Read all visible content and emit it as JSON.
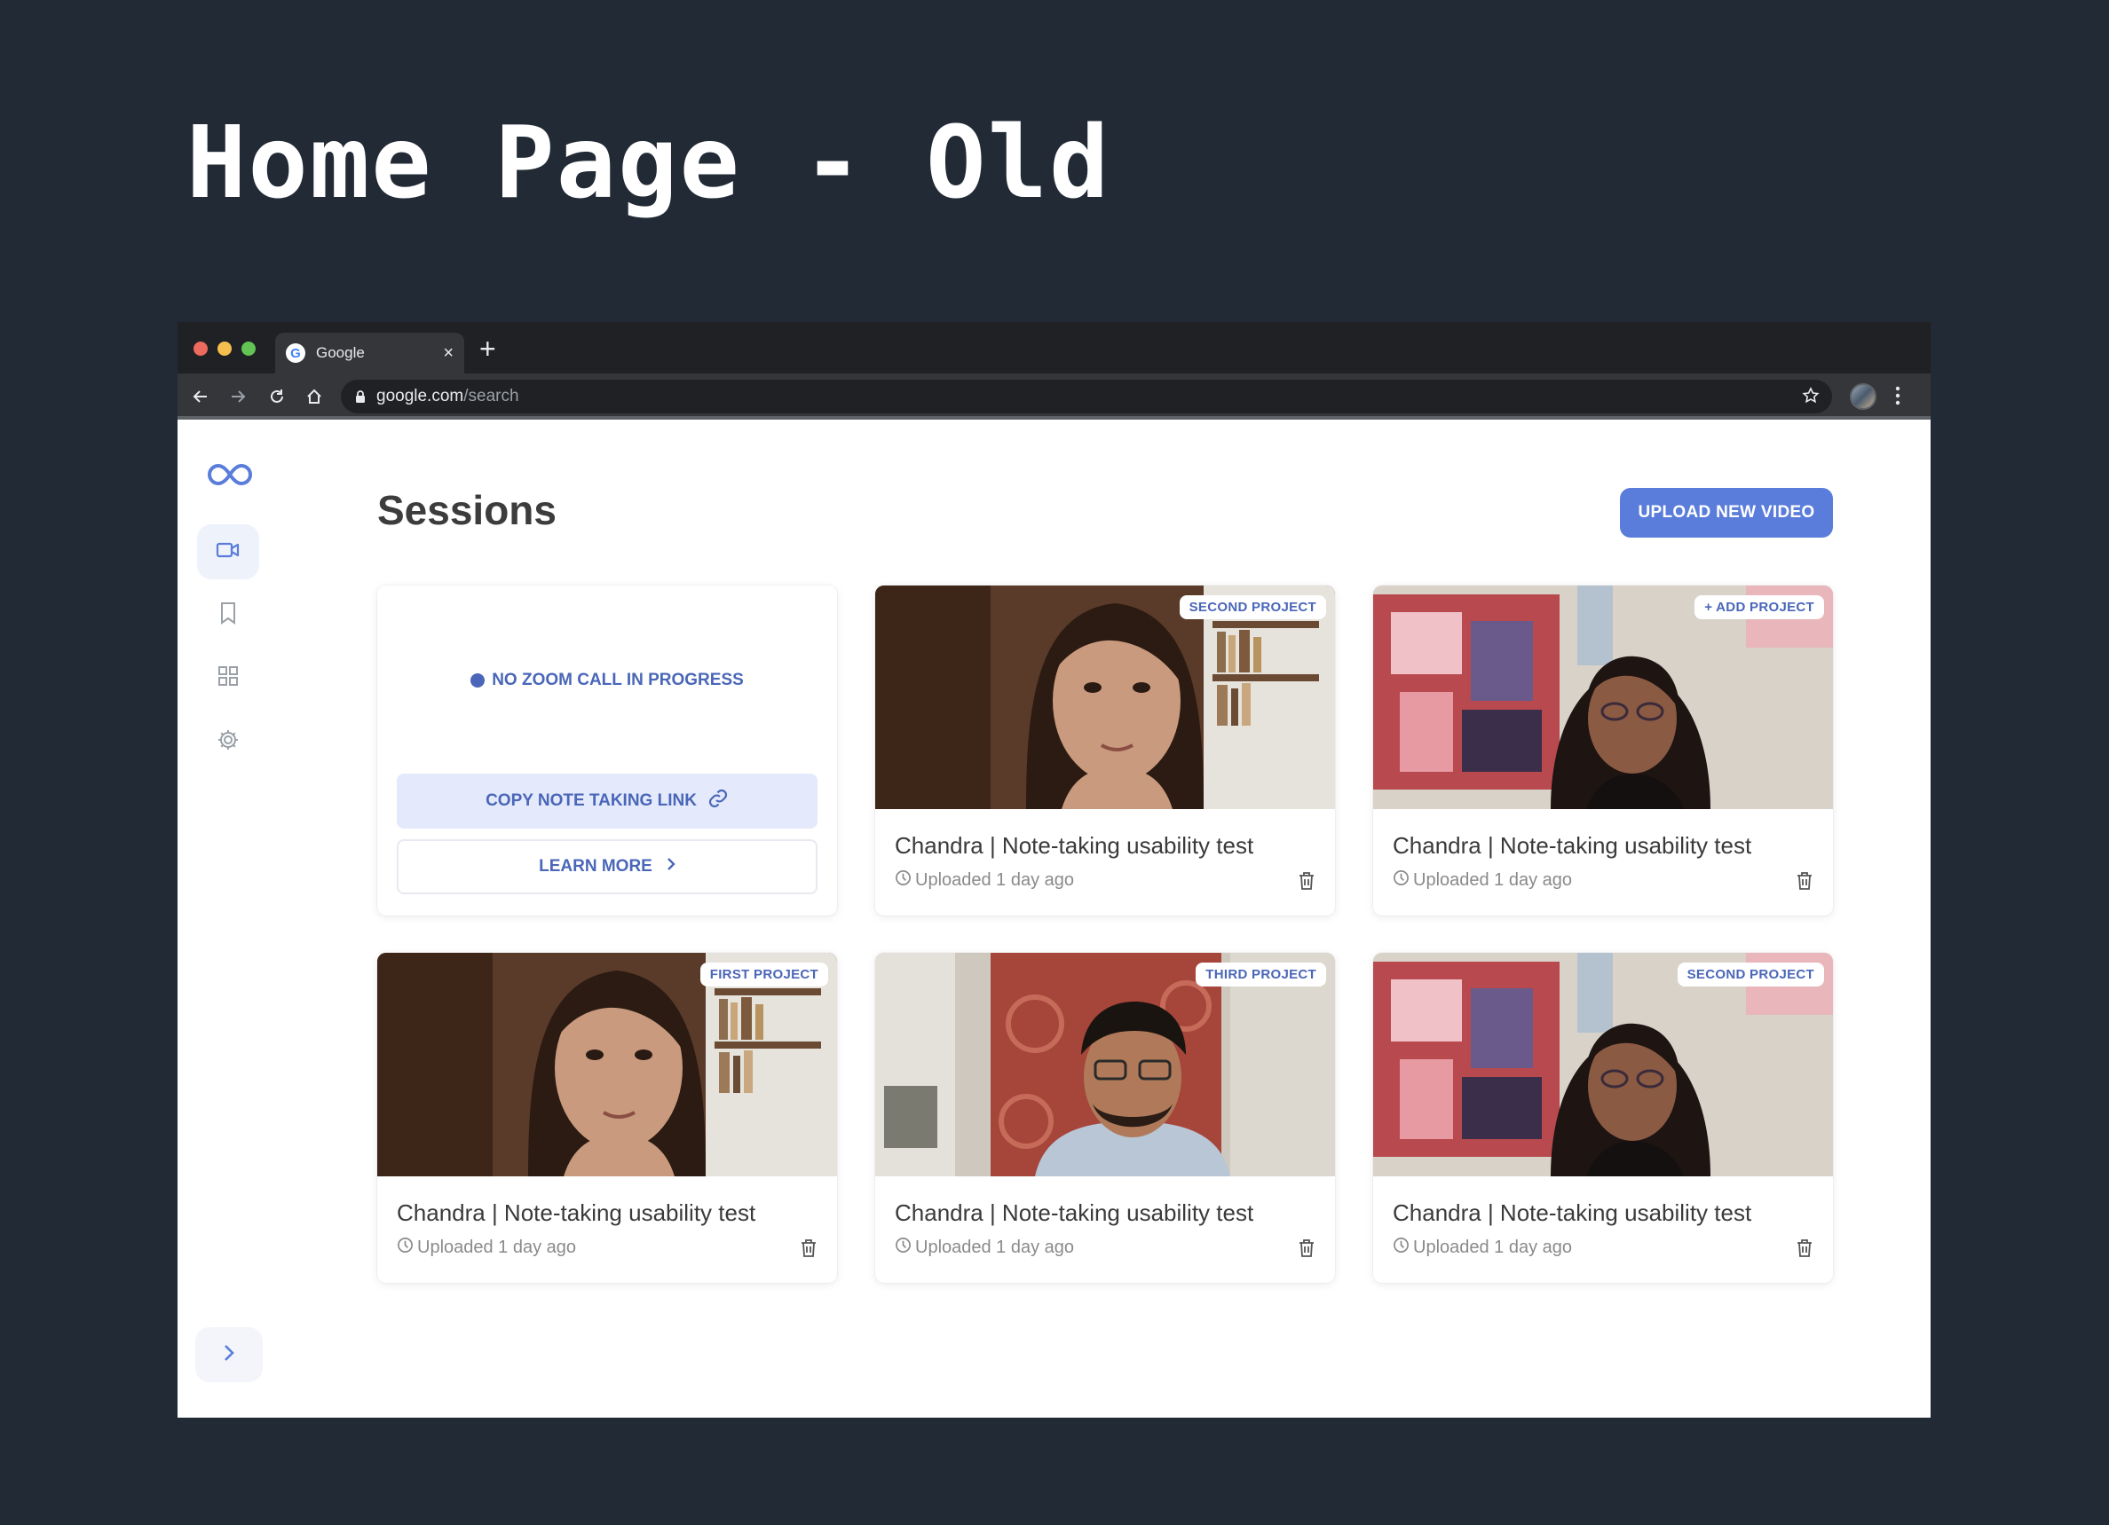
{
  "slide": {
    "title": "Home Page - Old"
  },
  "browser": {
    "tab_title": "Google",
    "favicon_letter": "G",
    "new_tab_symbol": "+",
    "close_symbol": "×",
    "url_host": "google.com",
    "url_path": "/search"
  },
  "app": {
    "page_title": "Sessions",
    "upload_label": "UPLOAD NEW VIDEO",
    "sidebar": [
      {
        "name": "videos",
        "icon": "video-icon",
        "active": true
      },
      {
        "name": "bookmarks",
        "icon": "bookmark-icon",
        "active": false
      },
      {
        "name": "projects",
        "icon": "grid-icon",
        "active": false
      },
      {
        "name": "settings",
        "icon": "gear-icon",
        "active": false
      }
    ],
    "zoom_card": {
      "status": "NO ZOOM CALL IN PROGRESS",
      "copy_label": "COPY NOTE TAKING LINK",
      "learn_label": "LEARN MORE"
    },
    "sessions": [
      {
        "badge": "SECOND PROJECT",
        "title": "Chandra | Note-taking usability test",
        "meta": "Uploaded 1 day ago",
        "thumb": "woman-bookshelf"
      },
      {
        "badge": "+ ADD PROJECT",
        "title": "Chandra | Note-taking usability test",
        "meta": "Uploaded 1 day ago",
        "thumb": "woman-art"
      },
      {
        "badge": "FIRST PROJECT",
        "title": "Chandra | Note-taking usability test",
        "meta": "Uploaded 1 day ago",
        "thumb": "woman-bookshelf"
      },
      {
        "badge": "THIRD PROJECT",
        "title": "Chandra | Note-taking usability test",
        "meta": "Uploaded 1 day ago",
        "thumb": "man-curtain"
      },
      {
        "badge": "SECOND PROJECT",
        "title": "Chandra | Note-taking usability test",
        "meta": "Uploaded 1 day ago",
        "thumb": "woman-art"
      }
    ]
  },
  "colors": {
    "background": "#222a36",
    "accent": "#5a7ddb",
    "accent_text": "#4a66b8"
  }
}
